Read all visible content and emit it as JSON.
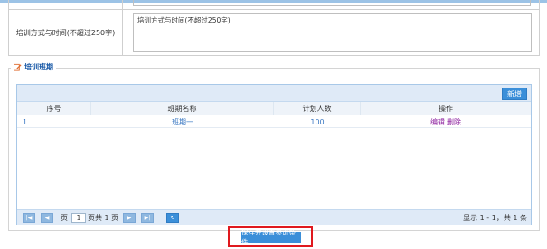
{
  "form": {
    "training_method_label": "培训方式与时间(不超过250字)",
    "training_method_value": "培训方式与时间(不超过250字)"
  },
  "section": {
    "legend": "培训班期",
    "icon": "edit-icon"
  },
  "grid": {
    "add_label": "新增",
    "columns": [
      "序号",
      "班期名称",
      "计划人数",
      "操作"
    ],
    "rows": [
      {
        "index": "1",
        "name": "班期一",
        "planned": "100",
        "edit": "编辑",
        "delete": "删除"
      }
    ],
    "pager": {
      "page_prefix": "页",
      "page_value": "1",
      "page_suffix": "页共 1 页",
      "summary": "显示 1 - 1，共 1 条",
      "icons": [
        "first-page-icon",
        "prev-page-icon",
        "next-page-icon",
        "last-page-icon",
        "refresh-icon"
      ]
    }
  },
  "footer": {
    "save_label": "保存并设置参训条件",
    "highlight_color": "#e0191e"
  },
  "colors": {
    "accent": "#3b8fd9",
    "link": "#3a78c3",
    "op_link": "#8a1a9c",
    "header_bg": "#dfeaf7"
  }
}
